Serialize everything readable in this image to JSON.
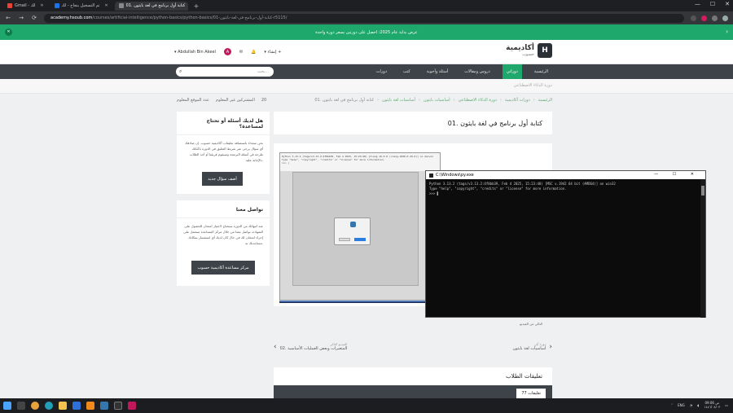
{
  "browser": {
    "tabs": [
      {
        "label": "Gmail - لك",
        "color": "#ea4335",
        "active": false
      },
      {
        "label": "تم التسجيل بنجاح - لك",
        "color": "#1a73e8",
        "active": false
      },
      {
        "label": "01. كتابة أول برنامج في لغة بايثون",
        "color": "#2b2f36",
        "active": true
      }
    ],
    "new_tab": "+",
    "url_host": "academy.hsoub.com",
    "url_path": "/courses/artificial-intelligence/python-basics/python-basics/01-كتابة-أول-برنامج-في-لغة-بايثون-r5115/"
  },
  "announce": {
    "text": "عرض بداية عام 2025: احصل على دورتين بسعر دورة واحدة",
    "close": "✕",
    "chevron": "›",
    "color": "#1fa86b"
  },
  "header": {
    "logo_title": "أكاديمية",
    "logo_sub": "حسوب",
    "username": "Abdullah Bin Akeel",
    "avatar": "A",
    "create_label": "إنشاء"
  },
  "nav": {
    "items": [
      "الرئيسية",
      "دوراتي",
      "دروس ومقالات",
      "أسئلة وأجوبة",
      "كتب",
      "دورات"
    ],
    "search_placeholder": "بحث..."
  },
  "subcrumb": "دورة الذكاء الاصطناعي",
  "breadcrumb": [
    "الرئيسية",
    "دورات أكاديمية",
    "دورة الذكاء الاصطناعي",
    "أساسيات بايثون",
    "أساسيات لغة بايثون",
    "01. كتابة أول برنامج في لغة بايثون"
  ],
  "stats": {
    "students": "المشتركين غير المعلوم",
    "location": "عدد الموقع المعلوم",
    "count": "20"
  },
  "lesson": {
    "title": "01. كتابة أول برنامج في لغة بايثون",
    "caption": "التالي من الفيديو",
    "video_lines": [
      "Python 3.13.2 (tags/v3.13.2:4f8bb39, Feb  4 2025, 15:23:48) [Clang 16.0.0 (clang-1600.0.26.6)] on darwin",
      "Type \"help\", \"copyright\", \"credits\" or \"license\" for more information.",
      ">>> |"
    ]
  },
  "pager": {
    "next_small": "دورة آلي",
    "next_big": "أساسيات لغة بايثون",
    "prev_small": "الفيديو التالي",
    "prev_big": "02. المتغيرات وبعض العمليات الأساسية"
  },
  "comments": {
    "title": "تعليقات الطلاب",
    "count": "77 تعليقات"
  },
  "sidebar": {
    "q_title": "هل لديك أسئلة أو تحتاج لمساعدة؟",
    "q_text": "نحن سعداء باستضافة تعليقات أكاديمية حسوب. إن صادفك أي سؤال يرجى عبر شريط التعليق في الدورة باكناتك طرحه في أسئلة البرمجة وسيقوم فريقنا أو أحد الطلاب بالإجابة عليه.",
    "q_button": "أضف سؤال جديد",
    "c_title": "تواصل معنا",
    "c_text": "عند انتهائك من الدورة ستحتاج لاجتياز امتحان للحصول على الشهادة، تواصل معنا من خلال مركز المساعدة سنعمل على إجراء امتحان لك في حال كان لديك أي استفسار بمكانك مساعدتك به.",
    "c_button": "مركز مساعدة أكاديمية حسوب"
  },
  "console": {
    "title": "C:\\Windows\\py.exe",
    "controls": "— ☐ ✕",
    "lines": [
      "Python 3.13.2 (tags/v3.13.2:4f8bb39, Feb  4 2025, 15:23:48) [MSC v.1942 64 bit (AMD64)] on win32",
      "Type \"help\", \"copyright\", \"credits\" or \"license\" for more information.",
      ">>> ▌"
    ]
  },
  "taskbar": {
    "lang": "ENG",
    "time": "09:06 ص",
    "date": "١٤٤٦/٠٨/٠٣"
  }
}
